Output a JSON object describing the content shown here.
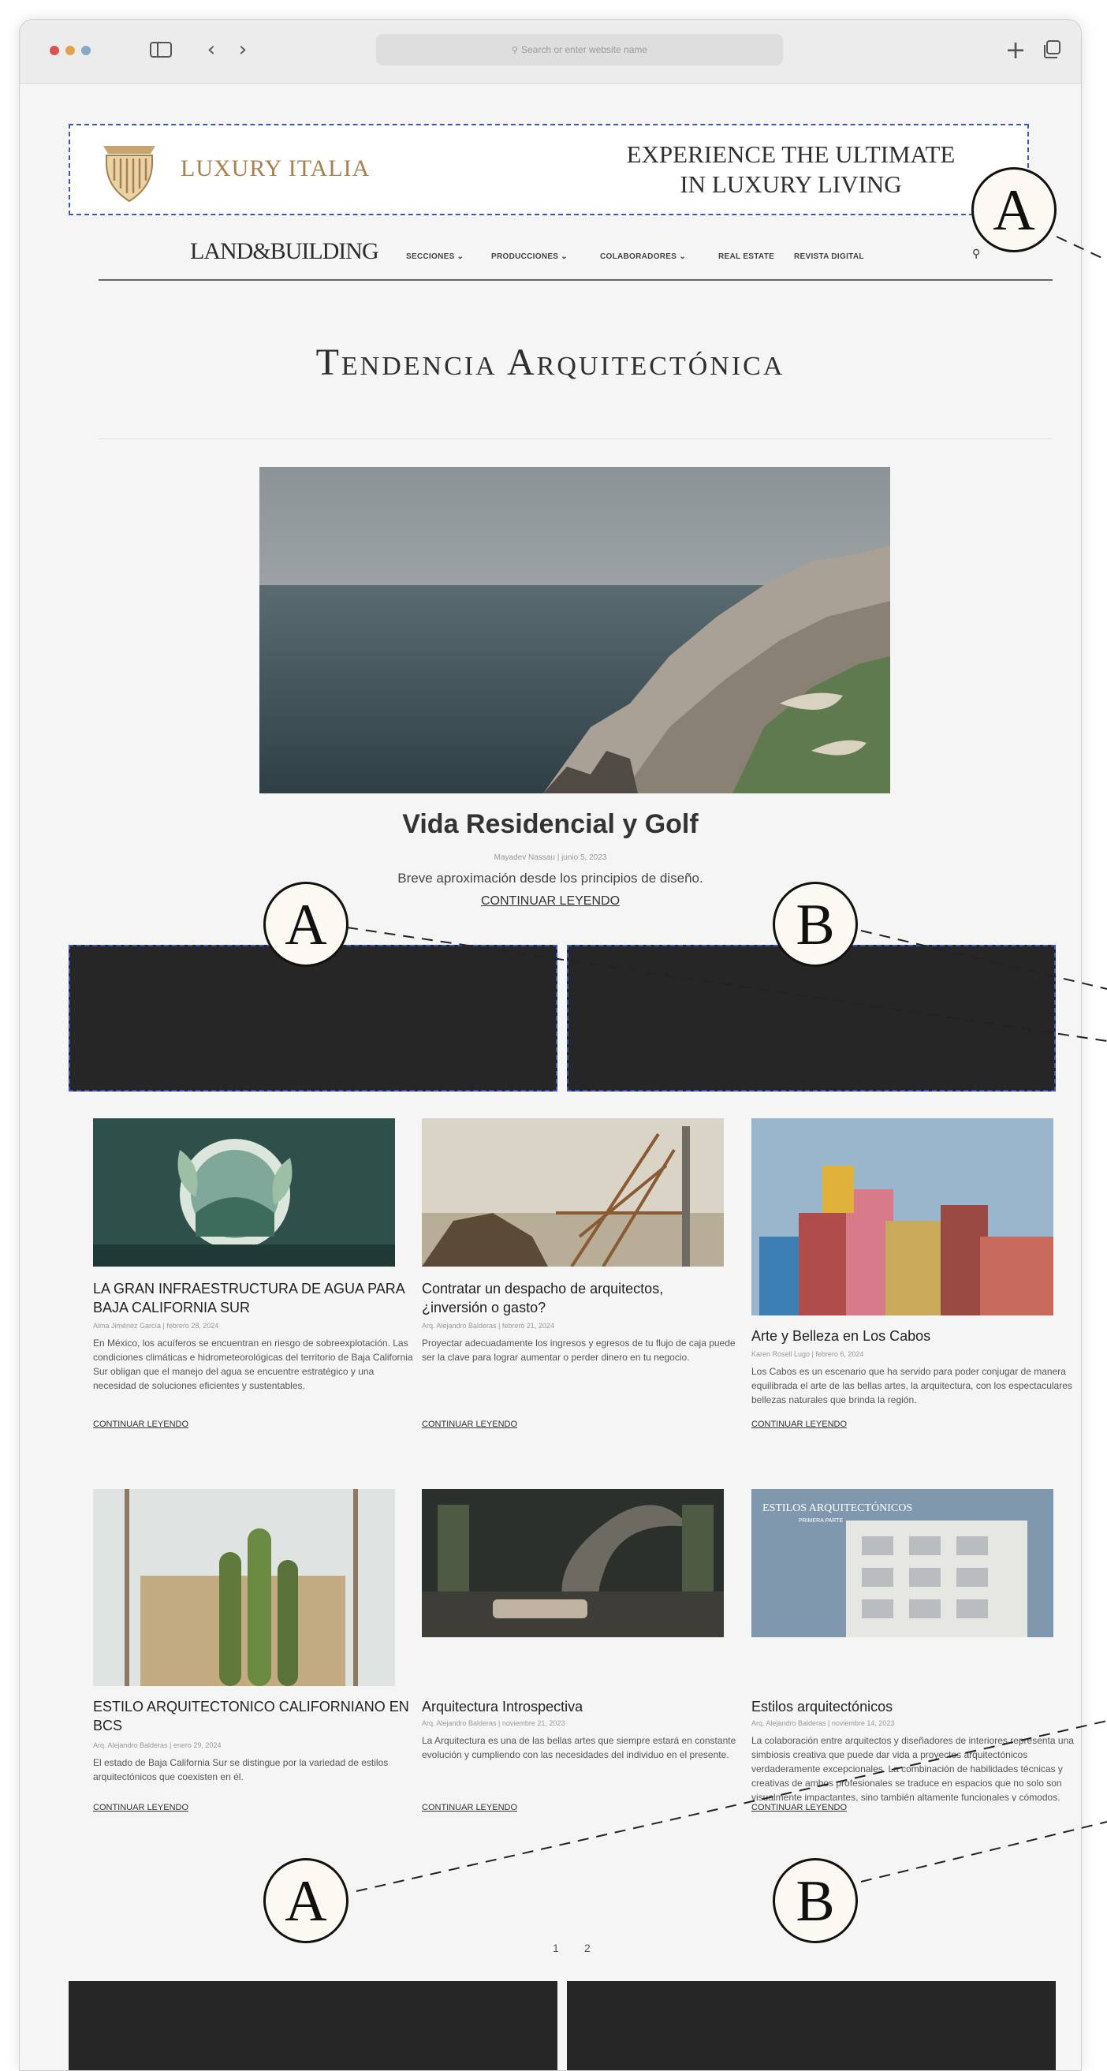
{
  "browser": {
    "url_placeholder": "Search or enter website name",
    "back_glyph": "‹",
    "forward_glyph": "›",
    "new_tab_glyph": "+",
    "icons": [
      "sidebar-icon",
      "chevron-left-icon",
      "chevron-right-icon",
      "search-icon",
      "plus-icon",
      "tabs-icon"
    ]
  },
  "top_ad": {
    "brand": "LUXURY ITALIA",
    "line1": "EXPERIENCE THE ULTIMATE",
    "line2": "IN LUXURY LIVING"
  },
  "nav": {
    "logo": "LAND&BUILDING",
    "items": [
      "SECCIONES ⌄",
      "PRODUCCIONES ⌄",
      "COLABORADORES ⌄",
      "REAL ESTATE",
      "REVISTA DIGITAL"
    ]
  },
  "section_title": "Tendencia Arquitectónica",
  "hero": {
    "title": "Vida Residencial y Golf",
    "meta": "Mayadev Nassau | junio 5, 2023",
    "description": "Breve aproximación desde los principios de diseño.",
    "more": "CONTINUAR LEYENDO"
  },
  "callouts": {
    "a": "A",
    "b": "B"
  },
  "cards": [
    {
      "title": "LA GRAN INFRAESTRUCTURA DE AGUA PARA BAJA CALIFORNIA SUR",
      "meta": "Alma Jiménez García | febrero 28, 2024",
      "excerpt": "En México, los acuíferos se encuentran en riesgo de sobreexplotación. Las condiciones climáticas e hidrometeorológicas del territorio de Baja California Sur obligan que el manejo del agua se encuentre estratégico y una necesidad de soluciones eficientes y sustentables.",
      "more": "CONTINUAR LEYENDO"
    },
    {
      "title": "Contratar un despacho de arquitectos, ¿inversión o gasto?",
      "meta": "Arq. Alejandro Balderas | febrero 21, 2024",
      "excerpt": "Proyectar adecuadamente los ingresos y egresos de tu flujo de caja puede ser la clave para lograr aumentar o perder dinero en tu negocio.",
      "more": "CONTINUAR LEYENDO"
    },
    {
      "title": "Arte y Belleza en Los Cabos",
      "meta": "Karen Rosell Lugo | febrero 6, 2024",
      "excerpt": "Los Cabos es un escenario que ha servido para poder conjugar de manera equilibrada el arte de las bellas artes, la arquitectura, con los espectaculares bellezas naturales que brinda la región.",
      "more": "CONTINUAR LEYENDO"
    },
    {
      "title": "ESTILO ARQUITECTONICO CALIFORNIANO EN BCS",
      "meta": "Arq. Alejandro Balderas | enero 29, 2024",
      "excerpt": "El estado de Baja California Sur se distingue por la variedad de estilos arquitectónicos que coexisten en él.",
      "more": "CONTINUAR LEYENDO"
    },
    {
      "title": "Arquitectura Introspectiva",
      "meta": "Arq. Alejandro Balderas | noviembre 21, 2023",
      "excerpt": "La Arquitectura es una de las bellas artes que siempre estará en constante evolución y cumpliendo con las necesidades del individuo en el presente.",
      "more": "CONTINUAR LEYENDO"
    },
    {
      "title": "Estilos arquitectónicos",
      "image_caption": "ESTILOS ARQUITECTÓNICOS",
      "image_subcaption": "PRIMERA PARTE",
      "meta": "Arq. Alejandro Balderas | noviembre 14, 2023",
      "excerpt": "La colaboración entre arquitectos y diseñadores de interiores representa una simbiosis creativa que puede dar vida a proyectos arquitectónicos verdaderamente excepcionales. La combinación de habilidades técnicas y creativas de ambos profesionales se traduce en espacios que no solo son visualmente impactantes, sino también altamente funcionales y cómodos.",
      "more": "CONTINUAR LEYENDO"
    }
  ],
  "pagination": [
    "1",
    "2"
  ],
  "colors": {
    "accent_gold": "#a8804e",
    "annotation_blue": "#3a55c8",
    "dark_ad": "#262626"
  }
}
